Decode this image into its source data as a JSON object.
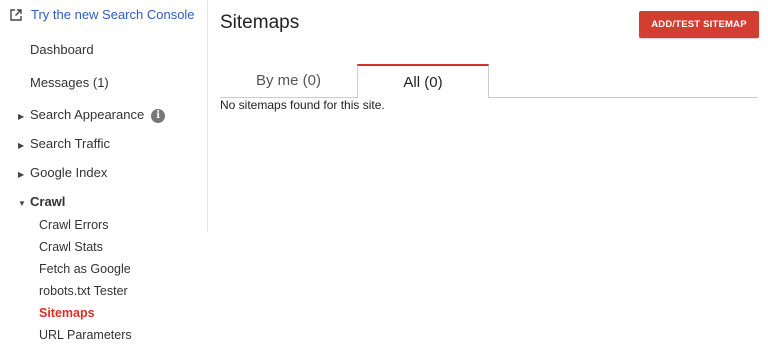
{
  "sidebar": {
    "try_link": "Try the new Search Console",
    "dashboard": "Dashboard",
    "messages": "Messages (1)",
    "search_appearance": "Search Appearance",
    "search_traffic": "Search Traffic",
    "google_index": "Google Index",
    "crawl": "Crawl",
    "crawl_items": [
      "Crawl Errors",
      "Crawl Stats",
      "Fetch as Google",
      "robots.txt Tester",
      "Sitemaps",
      "URL Parameters"
    ],
    "active_item": "Sitemaps"
  },
  "header": {
    "title": "Sitemaps",
    "add_button": "ADD/TEST SITEMAP"
  },
  "tabs": [
    {
      "label": "By me (0)",
      "selected": false
    },
    {
      "label": "All (0)",
      "selected": true
    }
  ],
  "main": {
    "empty_message": "No sitemaps found for this site."
  },
  "colors": {
    "accent": "#d93025",
    "button": "#d23f31",
    "link": "#2b5fbe"
  },
  "icons": {
    "external": "external-link-icon",
    "info": "info-icon"
  }
}
